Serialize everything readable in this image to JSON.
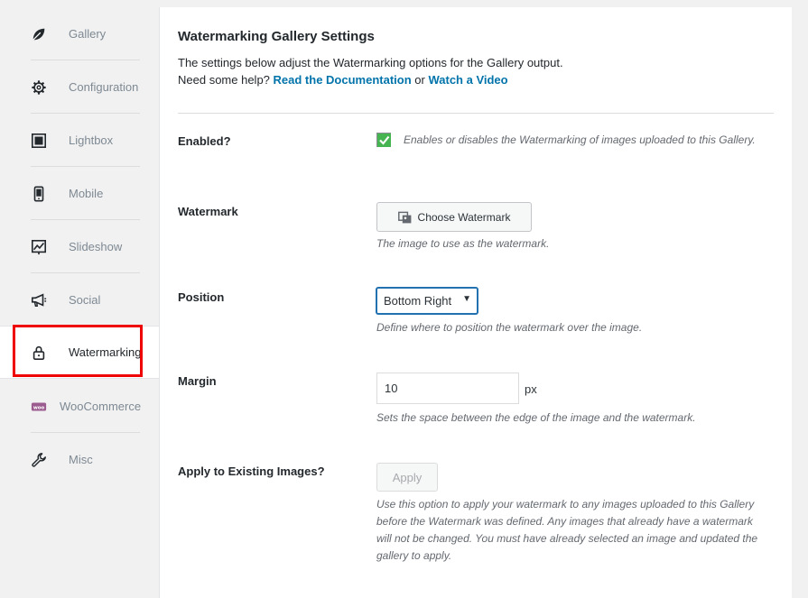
{
  "sidebar": {
    "items": [
      {
        "label": "Gallery",
        "icon": "leaf-icon"
      },
      {
        "label": "Configuration",
        "icon": "gear-icon"
      },
      {
        "label": "Lightbox",
        "icon": "lightbox-icon"
      },
      {
        "label": "Mobile",
        "icon": "mobile-icon"
      },
      {
        "label": "Slideshow",
        "icon": "chart-icon"
      },
      {
        "label": "Social",
        "icon": "megaphone-icon"
      },
      {
        "label": "Watermarking",
        "icon": "lock-icon"
      },
      {
        "label": "WooCommerce",
        "icon": "woo-icon"
      },
      {
        "label": "Misc",
        "icon": "wrench-icon"
      }
    ],
    "active": "Watermarking"
  },
  "main": {
    "title": "Watermarking Gallery Settings",
    "desc_line1": "The settings below adjust the Watermarking options for the Gallery output.",
    "help_prefix": "Need some help?",
    "doc_link": "Read the Documentation",
    "or_text": "or",
    "video_link": "Watch a Video"
  },
  "fields": {
    "enabled": {
      "label": "Enabled?",
      "checked": true,
      "help": "Enables or disables the Watermarking of images uploaded to this Gallery."
    },
    "watermark": {
      "label": "Watermark",
      "button": "Choose Watermark",
      "help": "The image to use as the watermark."
    },
    "position": {
      "label": "Position",
      "value": "Bottom Right",
      "help": "Define where to position the watermark over the image."
    },
    "margin": {
      "label": "Margin",
      "value": "10",
      "unit": "px",
      "help": "Sets the space between the edge of the image and the watermark."
    },
    "apply": {
      "label": "Apply to Existing Images?",
      "button": "Apply",
      "help": "Use this option to apply your watermark to any images uploaded to this Gallery before the Watermark was defined. Any images that already have a watermark will not be changed. You must have already selected an image and updated the gallery to apply."
    }
  },
  "colors": {
    "accent": "#0073aa",
    "check": "#46b450",
    "highlight": "#ee0000"
  }
}
